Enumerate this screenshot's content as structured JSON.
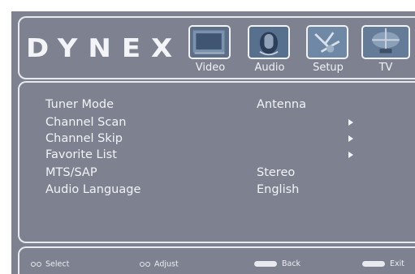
{
  "brand": {
    "logo": "DYNEX"
  },
  "tabs": [
    {
      "label": "Video"
    },
    {
      "label": "Audio"
    },
    {
      "label": "Setup"
    },
    {
      "label": "TV"
    }
  ],
  "menu": {
    "items": [
      {
        "label": "Tuner Mode",
        "value": "Antenna"
      },
      {
        "label": "Channel Scan",
        "value": ""
      },
      {
        "label": "Channel Skip",
        "value": ""
      },
      {
        "label": "Favorite List",
        "value": ""
      },
      {
        "label": "MTS/SAP",
        "value": "Stereo"
      },
      {
        "label": "Audio Language",
        "value": "English"
      }
    ]
  },
  "footer": {
    "select": "Select",
    "adjust": "Adjust",
    "back": "Back",
    "exit": "Exit"
  },
  "colors": {
    "background": "#7e8290",
    "frame": "#e7e9ee",
    "text": "#f2f3f6"
  },
  "icons": {
    "submenu": "triangle-right-icon",
    "nav": "arrow-pair-icon",
    "menu_key": "menu-key-icon",
    "exit_key": "exit-key-icon"
  }
}
